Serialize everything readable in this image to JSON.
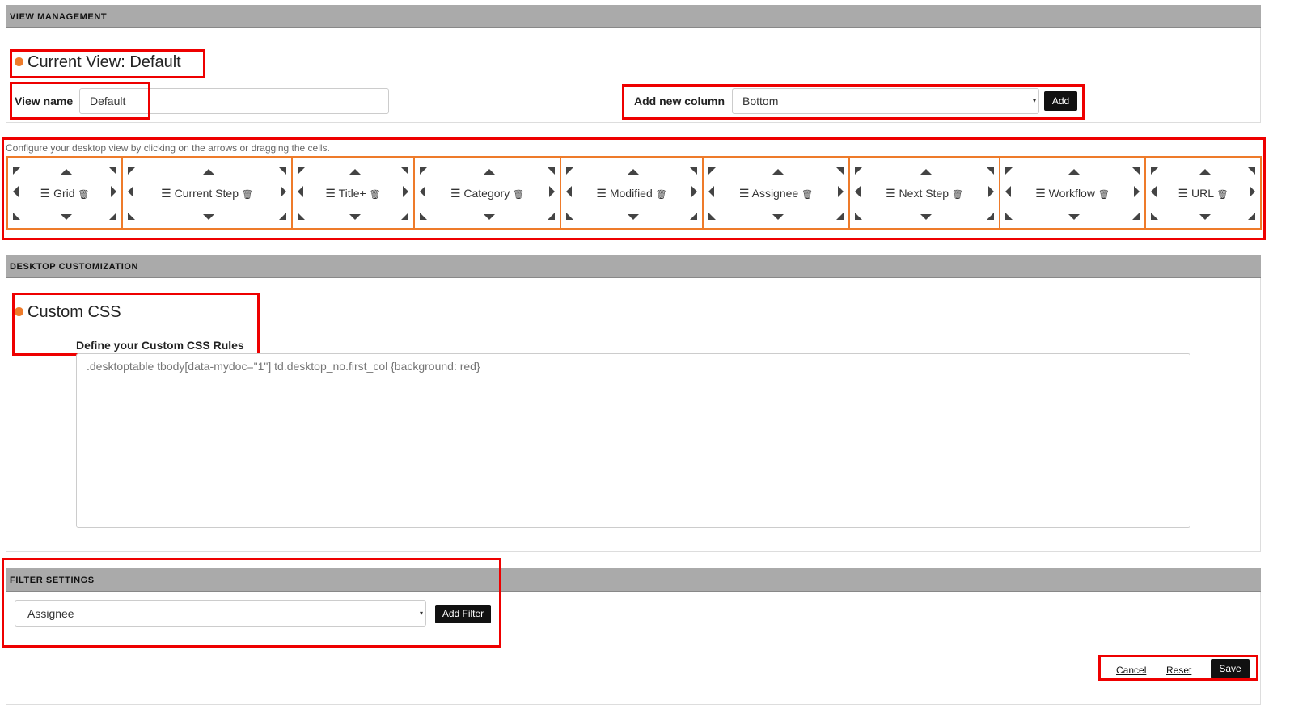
{
  "view_management": {
    "header": "VIEW MANAGEMENT",
    "current_view": "Current View: Default",
    "view_name_label": "View name",
    "view_name_value": "Default",
    "add_column_label": "Add new column",
    "add_column_value": "Bottom",
    "add_label": "Add"
  },
  "configure": {
    "hint": "Configure your desktop view by clicking on the arrows or dragging the cells.",
    "cells": [
      "Grid",
      "Current Step",
      "Title+",
      "Category",
      "Modified",
      "Assignee",
      "Next Step",
      "Workflow",
      "URL"
    ]
  },
  "desktop": {
    "header": "DESKTOP CUSTOMIZATION",
    "title": "Custom CSS",
    "rules_label": "Define your Custom CSS Rules",
    "css_placeholder": ".desktoptable tbody[data-mydoc=\"1\"] td.desktop_no.first_col {background: red}"
  },
  "filter": {
    "header": "FILTER SETTINGS",
    "value": "Assignee",
    "add_filter_label": "Add Filter"
  },
  "footer": {
    "cancel": "Cancel",
    "reset": "Reset",
    "save": "Save"
  },
  "colors": {
    "accent": "#ee7b2a",
    "header_bg": "#aaaaaa",
    "annotation": "#ee0000"
  }
}
